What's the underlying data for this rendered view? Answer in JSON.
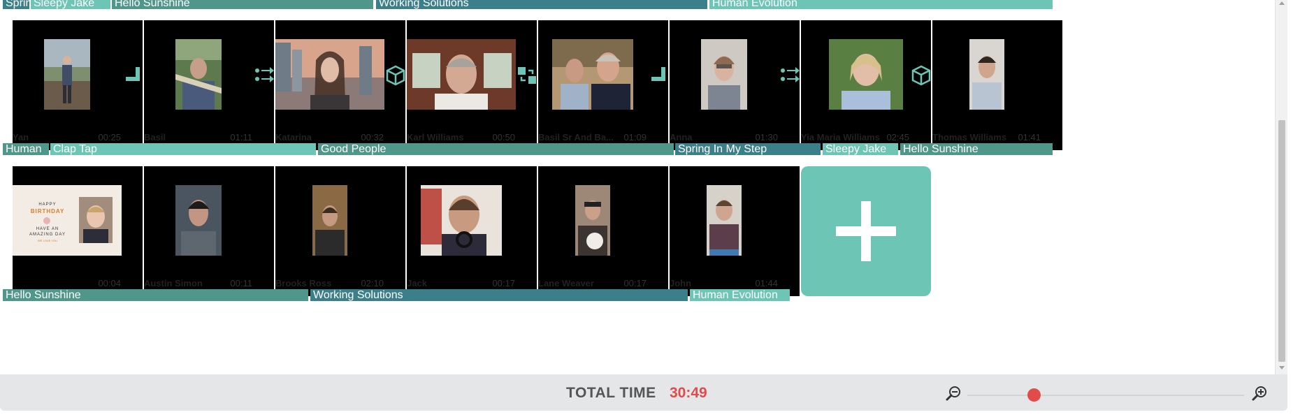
{
  "colors": {
    "accent": "#6cc5b5",
    "track_light": "#6cc5b5",
    "track_mid": "#4f978b",
    "track_dark": "#3b7f8b",
    "time_red": "#e24b4b",
    "footer_bg": "#e5e6e7"
  },
  "rows": [
    {
      "tracks": [
        {
          "label": "Spring In My Step",
          "tone": "dark"
        },
        {
          "label": "Sleepy Jake",
          "tone": "light"
        },
        {
          "label": "Hello Sunshine",
          "tone": "mid"
        },
        {
          "label": "Working Solutions",
          "tone": "dark"
        },
        {
          "label": "Human Evolution",
          "tone": "light"
        }
      ]
    },
    {
      "clips": [
        {
          "name": "Yan",
          "duration": "00:25",
          "thumb": "man-standing-garden"
        },
        {
          "name": "Basil",
          "duration": "01:11",
          "thumb": "man-in-hammock"
        },
        {
          "name": "Katarina",
          "duration": "00:32",
          "thumb": "woman-sunset-city"
        },
        {
          "name": "Karl Williams",
          "duration": "00:50",
          "thumb": "man-window"
        },
        {
          "name": "Basil Sr And Ba...",
          "duration": "01:09",
          "thumb": "two-men"
        },
        {
          "name": "Anna",
          "duration": "01:30",
          "thumb": "woman-glasses"
        },
        {
          "name": "Yia Maria Williams",
          "duration": "02:45",
          "thumb": "older-woman"
        },
        {
          "name": "Thomas Williams",
          "duration": "01:41",
          "thumb": "young-man"
        }
      ],
      "transitions": [
        "corner-step-icon",
        "slide-arrows-icon",
        "cube-icon",
        "swap-squares-icon",
        "corner-step-icon",
        "slide-arrows-icon",
        "cube-icon"
      ],
      "tracks": [
        {
          "label": "Human",
          "tone": "mid"
        },
        {
          "label": "Clap Tap",
          "tone": "light"
        },
        {
          "label": "Good People",
          "tone": "mid"
        },
        {
          "label": "Spring In My Step",
          "tone": "dark"
        },
        {
          "label": "Sleepy Jake",
          "tone": "light"
        },
        {
          "label": "Hello Sunshine",
          "tone": "mid"
        }
      ]
    },
    {
      "clips": [
        {
          "name": "",
          "duration": "00:04",
          "thumb": "birthday-card"
        },
        {
          "name": "Austin Simon",
          "duration": "00:11",
          "thumb": "man-shirt"
        },
        {
          "name": "Brooks Ross",
          "duration": "02:10",
          "thumb": "man-dark-room"
        },
        {
          "name": "Jack",
          "duration": "00:17",
          "thumb": "man-headphones"
        },
        {
          "name": "Lane Weaver",
          "duration": "00:17",
          "thumb": "man-with-cat"
        },
        {
          "name": "John",
          "duration": "01:44",
          "thumb": "man-sweater"
        }
      ],
      "card": {
        "line1": "HAPPY",
        "line2": "BIRTHDAY",
        "line3": "HAVE AN",
        "line4": "AMAZING DAY",
        "line5": "WE LOVE YOU"
      },
      "tracks": [
        {
          "label": "Hello Sunshine",
          "tone": "mid"
        },
        {
          "label": "Working Solutions",
          "tone": "dark"
        },
        {
          "label": "Human Evolution",
          "tone": "light"
        }
      ]
    }
  ],
  "add_button": {
    "icon": "plus-icon"
  },
  "footer": {
    "total_label": "TOTAL TIME",
    "total_value": "30:49",
    "zoom_out_icon": "zoom-out-icon",
    "zoom_in_icon": "zoom-in-icon",
    "zoom_level": 0.24
  }
}
